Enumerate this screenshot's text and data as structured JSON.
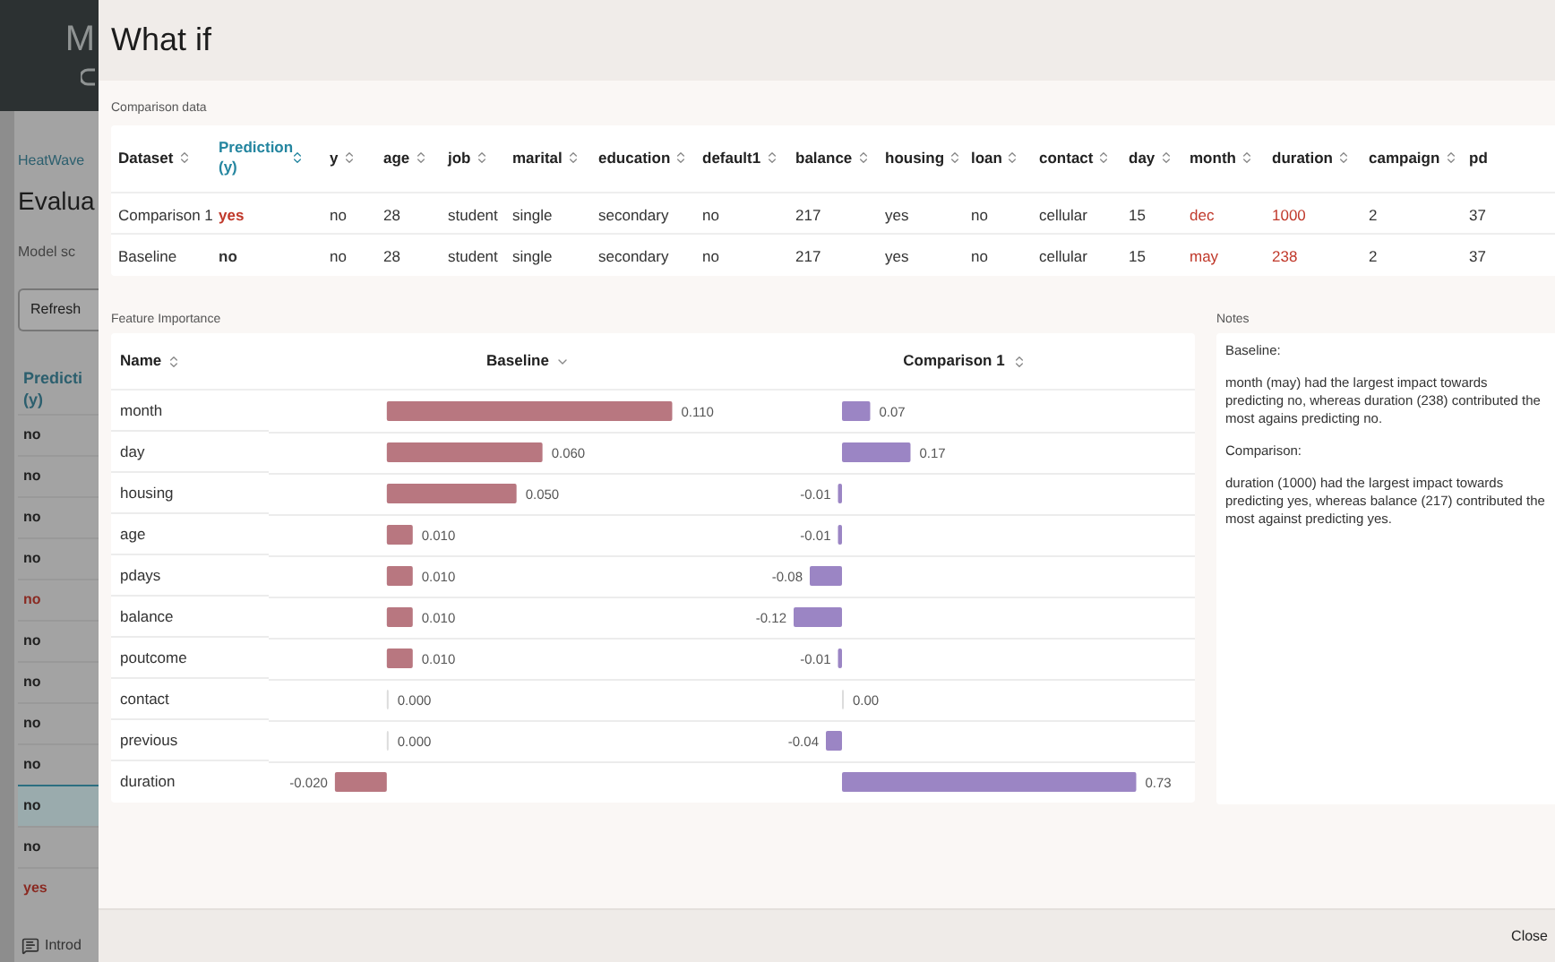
{
  "background_page": {
    "header_letter": "M",
    "breadcrumb": "HeatWave",
    "title": "Evalua",
    "subtitle": "Model sc",
    "refresh_button": "Refresh",
    "column_header": "Predicti (y)",
    "rows": [
      {
        "text": "no",
        "color": "#1f1f1f",
        "selected": false
      },
      {
        "text": "no",
        "color": "#1f1f1f",
        "selected": false
      },
      {
        "text": "no",
        "color": "#1f1f1f",
        "selected": false
      },
      {
        "text": "no",
        "color": "#1f1f1f",
        "selected": false
      },
      {
        "text": "no",
        "color": "#8a2a22",
        "selected": false
      },
      {
        "text": "no",
        "color": "#1f1f1f",
        "selected": false
      },
      {
        "text": "no",
        "color": "#1f1f1f",
        "selected": false
      },
      {
        "text": "no",
        "color": "#1f1f1f",
        "selected": false
      },
      {
        "text": "no",
        "color": "#1f1f1f",
        "selected": false
      },
      {
        "text": "no",
        "color": "#1f1f1f",
        "selected": true
      },
      {
        "text": "no",
        "color": "#1f1f1f",
        "selected": false
      },
      {
        "text": "yes",
        "color": "#8a2a22",
        "selected": false
      }
    ],
    "footer_link": "Introd"
  },
  "dialog": {
    "title": "What if",
    "comparison": {
      "label": "Comparison data",
      "columns": [
        {
          "label": "Dataset",
          "sorted": false
        },
        {
          "label": "Prediction (y)",
          "sorted": true
        },
        {
          "label": "y",
          "sorted": false
        },
        {
          "label": "age",
          "sorted": false
        },
        {
          "label": "job",
          "sorted": false
        },
        {
          "label": "marital",
          "sorted": false
        },
        {
          "label": "education",
          "sorted": false
        },
        {
          "label": "default1",
          "sorted": false
        },
        {
          "label": "balance",
          "sorted": false
        },
        {
          "label": "housing",
          "sorted": false
        },
        {
          "label": "loan",
          "sorted": false
        },
        {
          "label": "contact",
          "sorted": false
        },
        {
          "label": "day",
          "sorted": false
        },
        {
          "label": "month",
          "sorted": false
        },
        {
          "label": "duration",
          "sorted": false
        },
        {
          "label": "campaign",
          "sorted": false
        },
        {
          "label": "pd",
          "sorted": false
        }
      ],
      "rows": [
        [
          {
            "text": "Comparison 1",
            "highlighted": false
          },
          {
            "text": "yes",
            "highlighted": true
          },
          {
            "text": "no",
            "highlighted": false
          },
          {
            "text": "28",
            "highlighted": false
          },
          {
            "text": "student",
            "highlighted": false
          },
          {
            "text": "single",
            "highlighted": false
          },
          {
            "text": "secondary",
            "highlighted": false
          },
          {
            "text": "no",
            "highlighted": false
          },
          {
            "text": "217",
            "highlighted": false
          },
          {
            "text": "yes",
            "highlighted": false
          },
          {
            "text": "no",
            "highlighted": false
          },
          {
            "text": "cellular",
            "highlighted": false
          },
          {
            "text": "15",
            "highlighted": false
          },
          {
            "text": "dec",
            "highlighted": true
          },
          {
            "text": "1000",
            "highlighted": true
          },
          {
            "text": "2",
            "highlighted": false
          },
          {
            "text": "37",
            "highlighted": false
          }
        ],
        [
          {
            "text": "Baseline",
            "highlighted": false
          },
          {
            "text": "no",
            "highlighted": false
          },
          {
            "text": "no",
            "highlighted": false
          },
          {
            "text": "28",
            "highlighted": false
          },
          {
            "text": "student",
            "highlighted": false
          },
          {
            "text": "single",
            "highlighted": false
          },
          {
            "text": "secondary",
            "highlighted": false
          },
          {
            "text": "no",
            "highlighted": false
          },
          {
            "text": "217",
            "highlighted": false
          },
          {
            "text": "yes",
            "highlighted": false
          },
          {
            "text": "no",
            "highlighted": false
          },
          {
            "text": "cellular",
            "highlighted": false
          },
          {
            "text": "15",
            "highlighted": false
          },
          {
            "text": "may",
            "highlighted": true
          },
          {
            "text": "238",
            "highlighted": true
          },
          {
            "text": "2",
            "highlighted": false
          },
          {
            "text": "37",
            "highlighted": false
          }
        ]
      ]
    },
    "feature_importance": {
      "label": "Feature Importance",
      "columns": [
        {
          "label": "Name",
          "kind": "sortable"
        },
        {
          "label": "Baseline",
          "kind": "dropdown",
          "color": "#b87780"
        },
        {
          "label": "Comparison 1",
          "kind": "sortable",
          "color": "#9b85c4"
        }
      ],
      "rows": [
        {
          "name": "month",
          "baseline": "0.110",
          "comparison": "0.07"
        },
        {
          "name": "day",
          "baseline": "0.060",
          "comparison": "0.17"
        },
        {
          "name": "housing",
          "baseline": "0.050",
          "comparison": "-0.01"
        },
        {
          "name": "age",
          "baseline": "0.010",
          "comparison": "-0.01"
        },
        {
          "name": "pdays",
          "baseline": "0.010",
          "comparison": "-0.08"
        },
        {
          "name": "balance",
          "baseline": "0.010",
          "comparison": "-0.12"
        },
        {
          "name": "poutcome",
          "baseline": "0.010",
          "comparison": "-0.01"
        },
        {
          "name": "contact",
          "baseline": "0.000",
          "comparison": "0.00"
        },
        {
          "name": "previous",
          "baseline": "0.000",
          "comparison": "-0.04"
        },
        {
          "name": "duration",
          "baseline": "-0.020",
          "comparison": "0.73"
        }
      ]
    },
    "notes": {
      "label": "Notes",
      "paragraphs": [
        "Baseline:",
        "month (may) had the largest impact towards predicting no, whereas duration (238) contributed the most agains predicting no.",
        "Comparison:",
        "duration (1000) had the largest impact towards predicting yes, whereas balance (217) contributed the most against predicting yes."
      ]
    },
    "close_button": "Close"
  }
}
